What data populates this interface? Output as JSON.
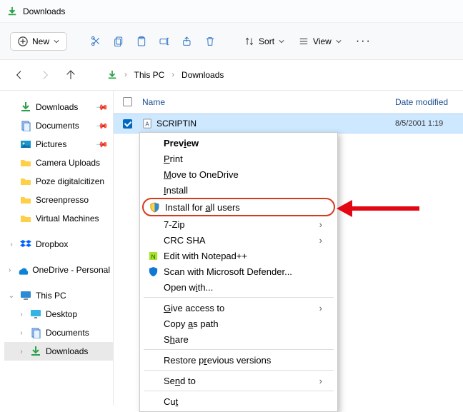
{
  "title": "Downloads",
  "toolbar": {
    "new_label": "New",
    "sort_label": "Sort",
    "view_label": "View"
  },
  "breadcrumbs": [
    "This PC",
    "Downloads"
  ],
  "sidebar": {
    "items": [
      {
        "label": "Downloads",
        "icon": "download",
        "pinned": true,
        "chev": null
      },
      {
        "label": "Documents",
        "icon": "documents",
        "pinned": true,
        "chev": null
      },
      {
        "label": "Pictures",
        "icon": "pictures",
        "pinned": true,
        "chev": null
      },
      {
        "label": "Camera Uploads",
        "icon": "folder",
        "pinned": false,
        "chev": null
      },
      {
        "label": "Poze digitalcitizen",
        "icon": "folder",
        "pinned": false,
        "chev": null
      },
      {
        "label": "Screenpresso",
        "icon": "folder",
        "pinned": false,
        "chev": null
      },
      {
        "label": "Virtual Machines",
        "icon": "folder",
        "pinned": false,
        "chev": null
      },
      {
        "label": "Dropbox",
        "icon": "dropbox",
        "pinned": false,
        "chev": "right"
      },
      {
        "label": "OneDrive - Personal",
        "icon": "onedrive",
        "pinned": false,
        "chev": "right"
      },
      {
        "label": "This PC",
        "icon": "thispc",
        "pinned": false,
        "chev": "down"
      },
      {
        "label": "Desktop",
        "icon": "desktop",
        "pinned": false,
        "chev": "right",
        "indent": 1
      },
      {
        "label": "Documents",
        "icon": "documents",
        "pinned": false,
        "chev": "right",
        "indent": 1
      },
      {
        "label": "Downloads",
        "icon": "download",
        "pinned": false,
        "chev": "right",
        "indent": 1,
        "selected": true
      }
    ]
  },
  "columns": {
    "name": "Name",
    "date": "Date modified"
  },
  "file": {
    "name": "SCRIPTIN",
    "date": "8/5/2001 1:19"
  },
  "context_menu": {
    "items": [
      {
        "label": "Preview",
        "bold": true,
        "u": 4
      },
      {
        "label": "Print",
        "u": 0
      },
      {
        "label": "Move to OneDrive",
        "u": 0
      },
      {
        "label": "Install",
        "u": 0
      },
      {
        "label": "Install for all users",
        "u": 12,
        "icon": "shield",
        "highlight": true
      },
      {
        "label": "7-Zip",
        "sub": true
      },
      {
        "label": "CRC SHA",
        "sub": true
      },
      {
        "label": "Edit with Notepad++",
        "icon": "npp"
      },
      {
        "label": "Scan with Microsoft Defender...",
        "icon": "defender"
      },
      {
        "label": "Open with...",
        "u": 6
      },
      {
        "sep": true
      },
      {
        "label": "Give access to",
        "u": 0,
        "sub": true
      },
      {
        "label": "Copy as path",
        "u": 5
      },
      {
        "label": "Share",
        "u": 1
      },
      {
        "sep": true
      },
      {
        "label": "Restore previous versions",
        "u": 9
      },
      {
        "sep": true
      },
      {
        "label": "Send to",
        "u": 2,
        "sub": true
      },
      {
        "sep": true
      },
      {
        "label": "Cut",
        "u": 2
      }
    ]
  }
}
